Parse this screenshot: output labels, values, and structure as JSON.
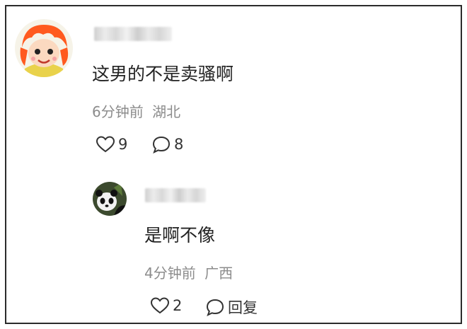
{
  "comments": [
    {
      "avatar_icon": "cartoon-girl-avatar-icon",
      "text": "这男的不是卖骚啊",
      "meta": "6分钟前 湖北",
      "likes": "9",
      "replies": "8"
    },
    {
      "avatar_icon": "panda-avatar-icon",
      "text": "是啊不像",
      "meta": "4分钟前 广西",
      "likes": "2",
      "reply_label": "回复"
    }
  ],
  "icons": {
    "like": "heart-outline-icon",
    "reply": "speech-bubble-icon"
  },
  "colors": {
    "text": "#222222",
    "meta": "#8c8c8c",
    "border": "#2b2b2b"
  }
}
